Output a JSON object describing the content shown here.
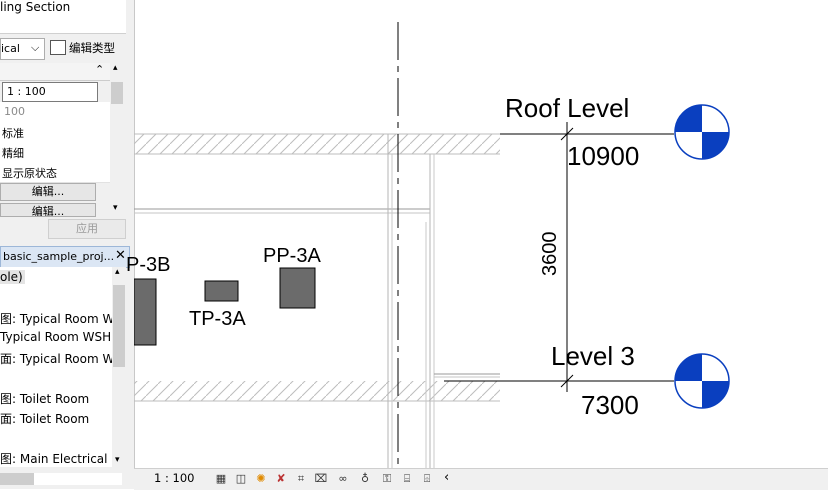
{
  "properties_panel": {
    "view_title": "ling Section",
    "type_selector": "ical",
    "edit_type_label": "编辑类型",
    "rows": [
      "1 : 100",
      "100",
      "标准",
      "精细",
      "显示原状态"
    ],
    "edit_button_1": "编辑...",
    "edit_button_2": "编辑...",
    "apply_button": "应用"
  },
  "project_browser": {
    "tab_title": "basic_sample_proj...",
    "items": [
      "ole)",
      "图: Typical Room W",
      "Typical Room WSHI",
      "面: Typical Room W",
      "图: Toilet Room",
      "面: Toilet Room",
      "图: Main Electrical"
    ]
  },
  "drawing": {
    "tags": [
      "P-3B",
      "TP-3A",
      "PP-3A"
    ],
    "levels": [
      {
        "name": "Roof Level",
        "elevation": "10900"
      },
      {
        "name": "Level 3",
        "elevation": "7300"
      }
    ],
    "dimension": "3600"
  },
  "status_bar": {
    "scale": "1 : 100"
  },
  "colors": {
    "level_head_blue": "#0a3fbf",
    "hatch": "#bdbdbd"
  }
}
